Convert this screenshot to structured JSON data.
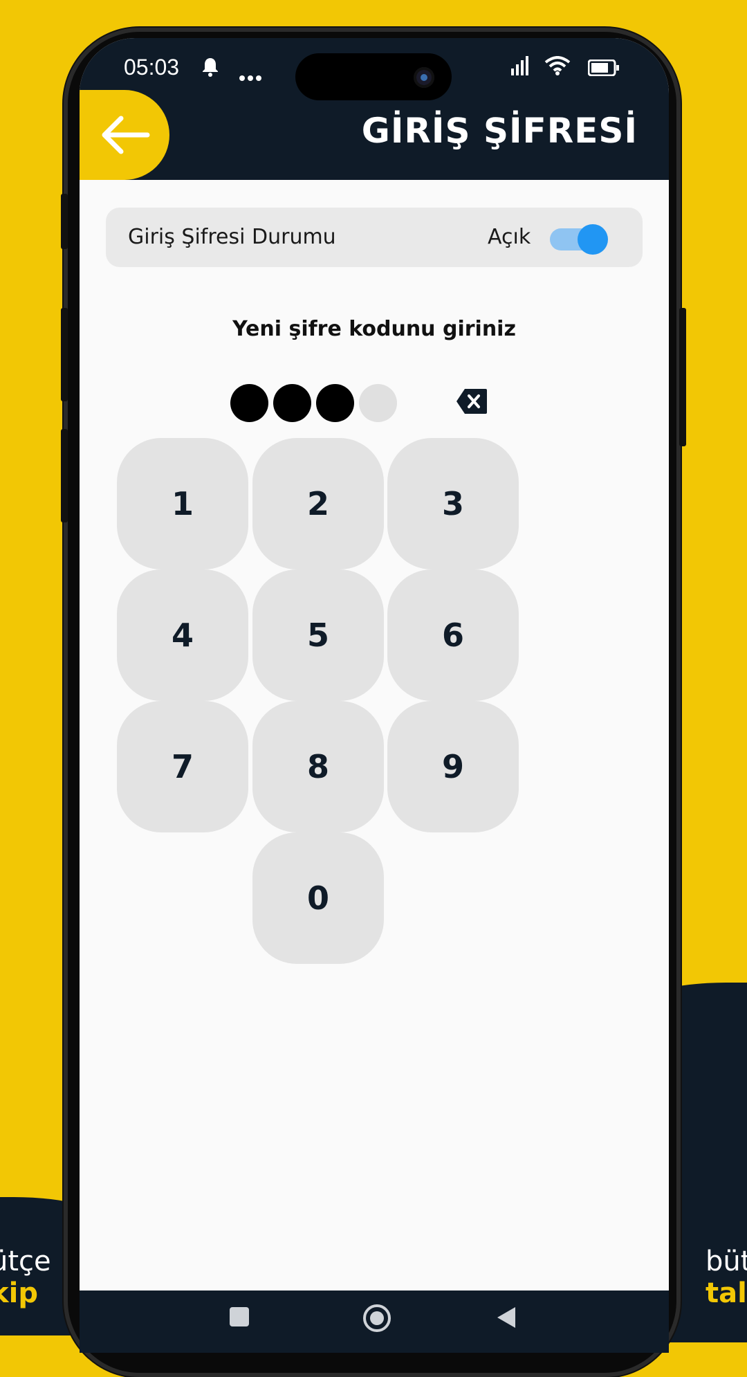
{
  "status_bar": {
    "time": "05:03",
    "bell_icon": "bell-icon",
    "more_icon": "more-dots-icon",
    "signal_icon": "signal-icon",
    "wifi_icon": "wifi-icon",
    "battery_icon": "battery-icon"
  },
  "header": {
    "title": "GİRİŞ ŞİFRESİ",
    "back_icon": "arrow-left-icon"
  },
  "password_status": {
    "label": "Giriş Şifresi Durumu",
    "value": "Açık",
    "toggle_on": true
  },
  "pin_entry": {
    "prompt": "Yeni şifre kodunu giriniz",
    "length": 4,
    "filled": 3,
    "delete_icon": "backspace-icon"
  },
  "keypad": {
    "keys": [
      "1",
      "2",
      "3",
      "4",
      "5",
      "6",
      "7",
      "8",
      "9",
      "0"
    ]
  },
  "nav": {
    "items": [
      "square-recent-icon",
      "circle-home-icon",
      "triangle-back-icon"
    ]
  },
  "promo": {
    "left_line1": "ütçe",
    "left_line2": "kip",
    "right_line1": "büt",
    "right_line2": "tal"
  },
  "colors": {
    "brand_yellow": "#f2c705",
    "navy": "#0f1b28",
    "toggle_blue": "#2196f3"
  }
}
